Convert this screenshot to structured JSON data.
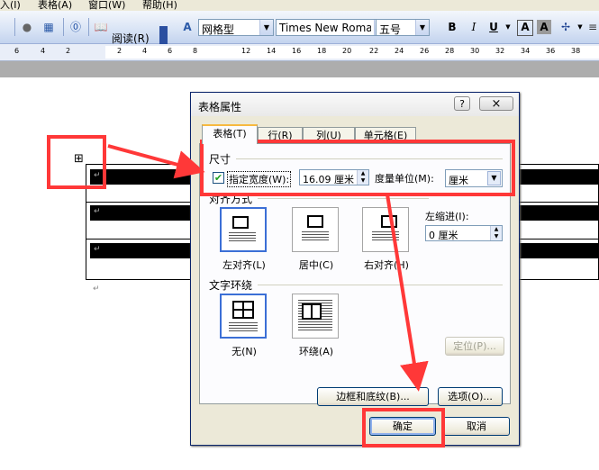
{
  "menubar": {
    "items": [
      "入(I)",
      "表格(A)",
      "窗口(W)",
      "帮助(H)"
    ]
  },
  "toolbar": {
    "read_label": "阅读(R)",
    "style_value": "网格型",
    "font_value": "Times New Roman",
    "size_value": "五号",
    "bold": "B",
    "italic": "I",
    "underline": "U",
    "font_color": "A",
    "char_shade": "A"
  },
  "ruler": {
    "numbers": [
      "6",
      "4",
      "2",
      "2",
      "4",
      "6",
      "8",
      "12",
      "14",
      "16",
      "18",
      "20",
      "22",
      "24",
      "26",
      "28",
      "30",
      "32",
      "34",
      "36",
      "38"
    ]
  },
  "dialog": {
    "title": "表格属性",
    "help_button": "?",
    "close_button": "×",
    "tabs": [
      "表格(T)",
      "行(R)",
      "列(U)",
      "单元格(E)"
    ],
    "size_section": "尺寸",
    "specify_width_label": "指定宽度(W):",
    "width_value": "16.09 厘米",
    "measure_label": "度量单位(M):",
    "measure_value": "厘米",
    "align_section": "对齐方式",
    "align_options": [
      "左对齐(L)",
      "居中(C)",
      "右对齐(H)"
    ],
    "indent_label": "左缩进(I):",
    "indent_value": "0 厘米",
    "wrap_section": "文字环绕",
    "wrap_options": [
      "无(N)",
      "环绕(A)"
    ],
    "position_button": "定位(P)...",
    "borders_button": "边框和底纹(B)...",
    "options_button": "选项(O)...",
    "ok_button": "确定",
    "cancel_button": "取消"
  },
  "document": {
    "move_handle": "⊞",
    "cell_marks": [
      "↵",
      "↵",
      "↵",
      "↵"
    ]
  },
  "colors": {
    "annotation": "#ff3838",
    "toolbar_top": "#f4f7fc",
    "dialog_bg": "#ece9d8"
  }
}
